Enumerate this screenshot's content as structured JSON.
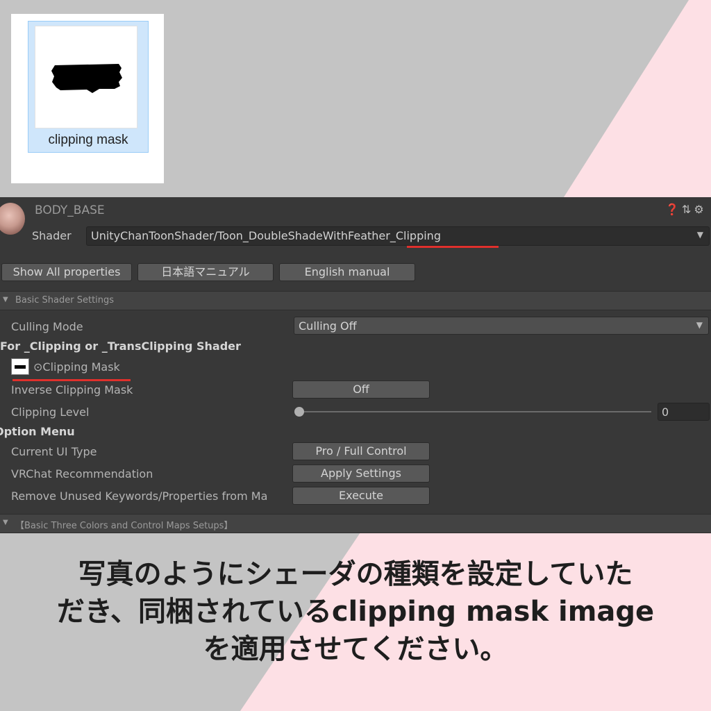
{
  "colors": {
    "background_gray": "#c4c4c4",
    "background_pink": "#fde0e5",
    "accent_red": "#e0302c",
    "inspector_bg": "#383838"
  },
  "asset": {
    "label": "clipping mask",
    "icon": "clipping-mask-texture-icon"
  },
  "inspector": {
    "material_name": "BODY_BASE",
    "header_icons": [
      "help-icon",
      "presets-icon",
      "settings-icon"
    ],
    "shader_label": "Shader",
    "shader_value": "UnityChanToonShader/Toon_DoubleShadeWithFeather_Clipping",
    "buttons": {
      "show_all": "Show All properties",
      "japanese_manual": "日本語マニュアル",
      "english_manual": "English manual"
    },
    "section_basic": "Basic Shader Settings",
    "culling_label": "Culling Mode",
    "culling_value": "Culling Off",
    "clipping_heading": "For _Clipping or _TransClipping Shader",
    "clipping_mask_label": "⊙Clipping Mask",
    "inverse_label": "Inverse Clipping Mask",
    "inverse_value": "Off",
    "clipping_level_label": "Clipping Level",
    "clipping_level_value": "0",
    "clipping_level_fraction": 0,
    "option_heading": "Option Menu",
    "ui_type_label": "Current UI Type",
    "ui_type_value": "Pro / Full Control",
    "vrchat_label": "VRChat Recommendation",
    "vrchat_value": "Apply Settings",
    "remove_label": "Remove Unused Keywords/Properties from Ma",
    "remove_value": "Execute",
    "section_three": "【Basic Three Colors and Control Maps Setups】"
  },
  "caption": {
    "line1": "写真のようにシェーダの種類を設定していた",
    "line2": "だき、同梱されているclipping mask image",
    "line3": "を適用させてください。"
  }
}
